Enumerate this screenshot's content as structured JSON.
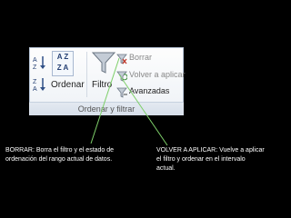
{
  "ribbon": {
    "sort_button_label": "Ordenar",
    "filter_button_label": "Filtro",
    "clear_label": "Borrar",
    "reapply_label": "Volver a aplicar",
    "advanced_label": "Avanzadas",
    "group_label": "Ordenar y filtrar",
    "sort_icon_text_top": "A Z",
    "sort_icon_text_bottom": "Z A"
  },
  "annotations": {
    "left": "BORRAR: Borra el filtro  y el estado de ordenación del rango actual de datos.",
    "right": "VOLVER A APLICAR: Vuelve a aplicar el filtro y ordenar en el intervalo actual."
  },
  "colors": {
    "background": "#000000",
    "connector_line": "#7ecf6a"
  }
}
